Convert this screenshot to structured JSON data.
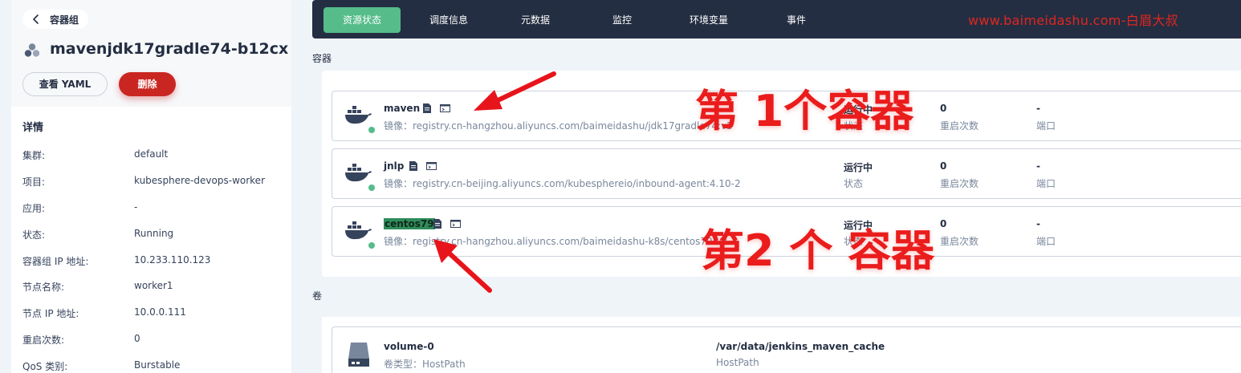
{
  "left": {
    "back_label": "容器组",
    "pod_name": "mavenjdk17gradle74-b12cx",
    "view_yaml_label": "查看 YAML",
    "delete_label": "删除",
    "details_title": "详情",
    "details": [
      {
        "label": "集群:",
        "value": "default"
      },
      {
        "label": "项目:",
        "value": "kubesphere-devops-worker"
      },
      {
        "label": "应用:",
        "value": "-"
      },
      {
        "label": "状态:",
        "value": "Running"
      },
      {
        "label": "容器组 IP 地址:",
        "value": "10.233.110.123"
      },
      {
        "label": "节点名称:",
        "value": "worker1"
      },
      {
        "label": "节点 IP 地址:",
        "value": "10.0.0.111"
      },
      {
        "label": "重启次数:",
        "value": "0"
      },
      {
        "label": "QoS 类别:",
        "value": "Burstable"
      }
    ]
  },
  "tabs": [
    "资源状态",
    "调度信息",
    "元数据",
    "监控",
    "环境变量",
    "事件"
  ],
  "watermark": "www.baimeidashu.com-白眉大叔",
  "sections": {
    "containers": "容器",
    "volumes": "卷"
  },
  "containers": [
    {
      "name": "maven",
      "image": "镜像：registry.cn-hangzhou.aliyuncs.com/baimeidashu/jdk17gradle74:v5",
      "status": "运行中",
      "status_label": "状态",
      "restarts": "0",
      "restarts_label": "重启次数",
      "ports": "-",
      "ports_label": "端口"
    },
    {
      "name": "jnlp",
      "image": "镜像：registry.cn-beijing.aliyuncs.com/kubesphereio/inbound-agent:4.10-2",
      "status": "运行中",
      "status_label": "状态",
      "restarts": "0",
      "restarts_label": "重启次数",
      "ports": "-",
      "ports_label": "端口"
    },
    {
      "name": "centos79",
      "image": "镜像：registry.cn-hangzhou.aliyuncs.com/baimeidashu-k8s/centos79:v2",
      "status": "运行中",
      "status_label": "状态",
      "restarts": "0",
      "restarts_label": "重启次数",
      "ports": "-",
      "ports_label": "端口"
    }
  ],
  "volume": {
    "name": "volume-0",
    "type": "卷类型：HostPath",
    "path": "/var/data/jenkins_maven_cache",
    "path_type": "HostPath"
  },
  "annotations": {
    "first": "第 1个容器",
    "second": "第2 个 容器"
  },
  "colors": {
    "accent_green": "#55bc8a",
    "delete_red": "#ca2621",
    "tabbar_dark": "#242e42",
    "annotation_red": "#ea1c1c"
  }
}
